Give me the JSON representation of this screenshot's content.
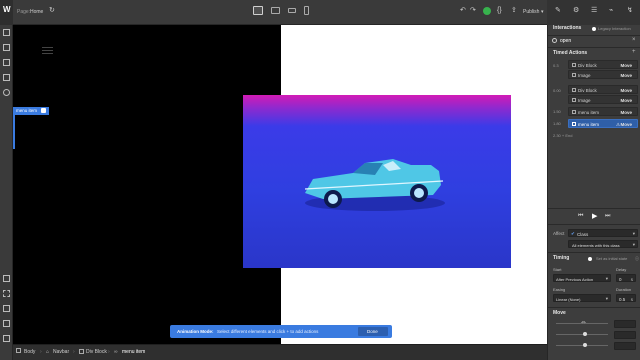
{
  "topbar": {
    "page_label": "Page:",
    "page_name": "Home",
    "publish_label": "Publish"
  },
  "canvas": {
    "selected_element_label": "menu item",
    "image_alt": "Blue vintage convertible car on blue and magenta background",
    "colors": {
      "bg_dark": "#000000",
      "bg_light": "#ffffff",
      "photo_top": "#d21bb6",
      "photo_blue": "#2f3fe0"
    }
  },
  "animation_bar": {
    "title": "Animation Mode:",
    "message": "Select different elements and click + to add actions",
    "done_label": "Done"
  },
  "breadcrumbs": [
    "Body",
    "Navbar",
    "Div Block",
    "menu item"
  ],
  "panel": {
    "header_title": "Interactions",
    "legacy_label": "Legacy Interaction",
    "trigger_name": "open",
    "timed_actions_title": "Timed Actions",
    "action_groups": [
      {
        "time": "0.3",
        "items": [
          {
            "label": "Div Block",
            "action": "Move"
          },
          {
            "label": "Image",
            "action": "Move"
          }
        ]
      },
      {
        "time": "0.00",
        "items": [
          {
            "label": "Div Block",
            "action": "Move"
          },
          {
            "label": "Image",
            "action": "Move"
          }
        ]
      },
      {
        "time": "1.50",
        "items": [
          {
            "label": "menu item",
            "action": "Move"
          }
        ]
      },
      {
        "time": "1.80",
        "items": [
          {
            "label": "menu item",
            "action": "Move"
          }
        ]
      }
    ],
    "end_label": "2.30 + End",
    "affect_label": "Affect",
    "affect_value": "Class",
    "affect_scope": "All elements with this class",
    "timing_title": "Timing",
    "initial_state_label": "Set as initial state",
    "start_label": "Start",
    "start_value": "After Previous Action",
    "delay_label": "Delay",
    "delay_value": "0",
    "delay_unit": "s",
    "easing_label": "Easing",
    "easing_value": "Linear (None)",
    "duration_label": "Duration",
    "duration_value": "0.5",
    "duration_unit": "s",
    "move_title": "Move"
  }
}
